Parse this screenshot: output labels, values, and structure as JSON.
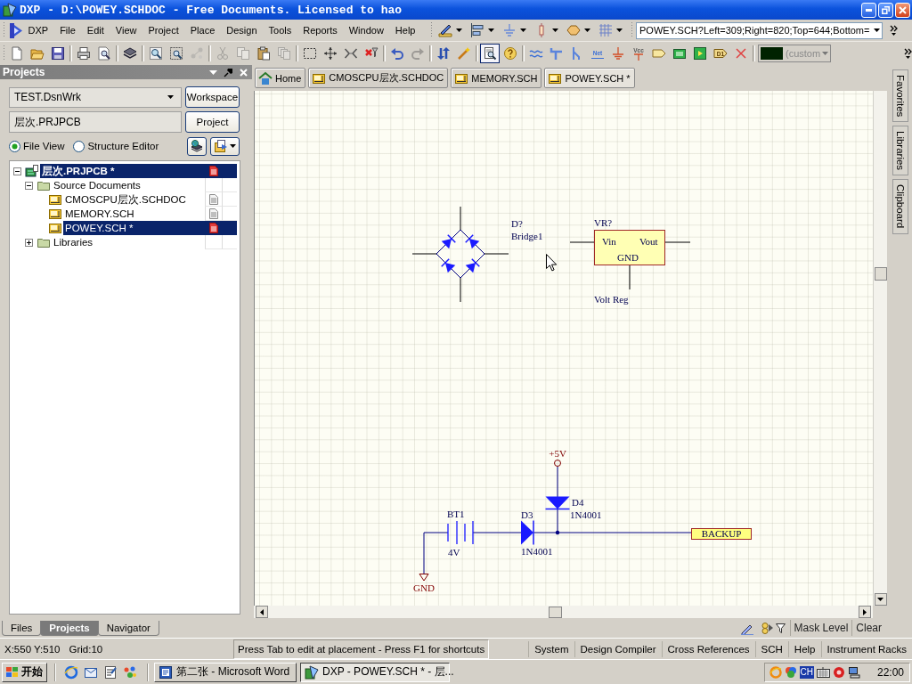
{
  "title_bar": {
    "title": "DXP - D:\\POWEY.SCHDOC - Free Documents. Licensed to hao"
  },
  "menu_bar": {
    "items": [
      "DXP",
      "File",
      "Edit",
      "View",
      "Project",
      "Place",
      "Design",
      "Tools",
      "Reports",
      "Window",
      "Help"
    ],
    "address": "POWEY.SCH?Left=309;Right=820;Top=644;Bottom="
  },
  "standard_toolbar": {
    "buttons": [
      {
        "disabled": false,
        "pressed": false
      },
      {
        "disabled": false,
        "pressed": false
      },
      {
        "disabled": false,
        "pressed": false
      },
      {
        "disabled": false,
        "pressed": false
      },
      {
        "disabled": false,
        "pressed": false
      },
      {
        "disabled": false,
        "pressed": false
      },
      {
        "disabled": false,
        "pressed": false
      },
      {
        "disabled": false,
        "pressed": false
      },
      {
        "disabled": true,
        "pressed": false
      },
      {
        "disabled": true,
        "pressed": false
      },
      {
        "disabled": true,
        "pressed": false
      },
      {
        "disabled": false,
        "pressed": false
      },
      {
        "disabled": true,
        "pressed": false
      },
      {
        "disabled": false,
        "pressed": false
      },
      {
        "disabled": false,
        "pressed": false
      },
      {
        "disabled": false,
        "pressed": false
      },
      {
        "disabled": false,
        "pressed": false
      },
      {
        "disabled": false,
        "pressed": false
      },
      {
        "disabled": true,
        "pressed": false
      },
      {
        "disabled": false,
        "pressed": false
      },
      {
        "disabled": false,
        "pressed": false
      },
      {
        "disabled": false,
        "pressed": true
      },
      {
        "disabled": false,
        "pressed": false
      },
      {
        "disabled": false,
        "pressed": false
      },
      {
        "disabled": false,
        "pressed": false
      },
      {
        "disabled": false,
        "pressed": false
      },
      {
        "disabled": false,
        "pressed": false,
        "label": "Net"
      },
      {
        "disabled": false,
        "pressed": false
      },
      {
        "disabled": false,
        "pressed": false,
        "label": "Vcc"
      },
      {
        "disabled": false,
        "pressed": false
      },
      {
        "disabled": false,
        "pressed": false
      },
      {
        "disabled": false,
        "pressed": false
      },
      {
        "disabled": false,
        "pressed": false,
        "label": "D1"
      },
      {
        "disabled": false,
        "pressed": false
      }
    ],
    "color_picker": {
      "value": "(custom",
      "disabled": true
    }
  },
  "projects_panel": {
    "title": "Projects",
    "workspace": "TEST.DsnWrk",
    "workspace_button": "Workspace",
    "project": "层次.PRJPCB",
    "project_button": "Project",
    "view_options": [
      {
        "label": "File View",
        "selected": true
      },
      {
        "label": "Structure Editor",
        "selected": false
      }
    ],
    "tree": [
      {
        "kind": "project",
        "label": "层次.PRJPCB *",
        "expanded": true,
        "selected": true,
        "modified": true,
        "children": [
          {
            "kind": "folder",
            "label": "Source Documents",
            "expanded": true,
            "selected": false,
            "children": [
              {
                "kind": "schematic",
                "label": "CMOSCPU层次.SCHDOC",
                "selected": false,
                "modified": false
              },
              {
                "kind": "schematic",
                "label": "MEMORY.SCH",
                "selected": false,
                "modified": false
              },
              {
                "kind": "schematic",
                "label": "POWEY.SCH *",
                "selected": true,
                "modified": true
              }
            ]
          },
          {
            "kind": "folder",
            "label": "Libraries",
            "expanded": false,
            "selected": false
          }
        ]
      }
    ],
    "tabs": [
      {
        "label": "Files",
        "selected": false
      },
      {
        "label": "Projects",
        "selected": true
      },
      {
        "label": "Navigator",
        "selected": false
      }
    ]
  },
  "document_tabs": [
    {
      "label": "Home",
      "kind": "home",
      "selected": false
    },
    {
      "label": "CMOSCPU层次.SCHDOC",
      "kind": "schematic",
      "selected": false
    },
    {
      "label": "MEMORY.SCH",
      "kind": "schematic",
      "selected": false
    },
    {
      "label": "POWEY.SCH *",
      "kind": "schematic",
      "selected": true
    }
  ],
  "schematic": {
    "parts": [
      {
        "kind": "bridge",
        "designator": "D?",
        "comment": "Bridge1"
      },
      {
        "kind": "regulator",
        "designator": "VR?",
        "comment": "Volt Reg",
        "pins": [
          "Vin",
          "Vout",
          "GND"
        ]
      },
      {
        "kind": "power_port",
        "net": "+5V"
      },
      {
        "kind": "diode",
        "designator": "D4",
        "comment": "1N4001"
      },
      {
        "kind": "battery",
        "designator": "BT1",
        "comment": "4V"
      },
      {
        "kind": "diode",
        "designator": "D3",
        "comment": "1N4001"
      },
      {
        "kind": "port",
        "net": "BACKUP"
      },
      {
        "kind": "ground",
        "net": "GND"
      }
    ]
  },
  "side_tabs": [
    "Favorites",
    "Libraries",
    "Clipboard"
  ],
  "sheet_bar": {
    "buttons": [
      "Mask Level",
      "Clear"
    ]
  },
  "status_bar": {
    "coordinates": "X:550 Y:510",
    "grid": "Grid:10",
    "message": "Press Tab to edit at placement - Press F1 for shortcuts",
    "panel_buttons": [
      "System",
      "Design Compiler",
      "Cross References",
      "SCH",
      "Help",
      "Instrument Racks"
    ]
  },
  "taskbar": {
    "start": "开始",
    "tasks": [
      {
        "label": "第二张 - Microsoft Word",
        "kind": "word",
        "selected": false
      },
      {
        "label": "DXP - POWEY.SCH * - 层...",
        "kind": "dxp",
        "selected": true
      }
    ],
    "language": "CH",
    "clock": "22:00"
  }
}
